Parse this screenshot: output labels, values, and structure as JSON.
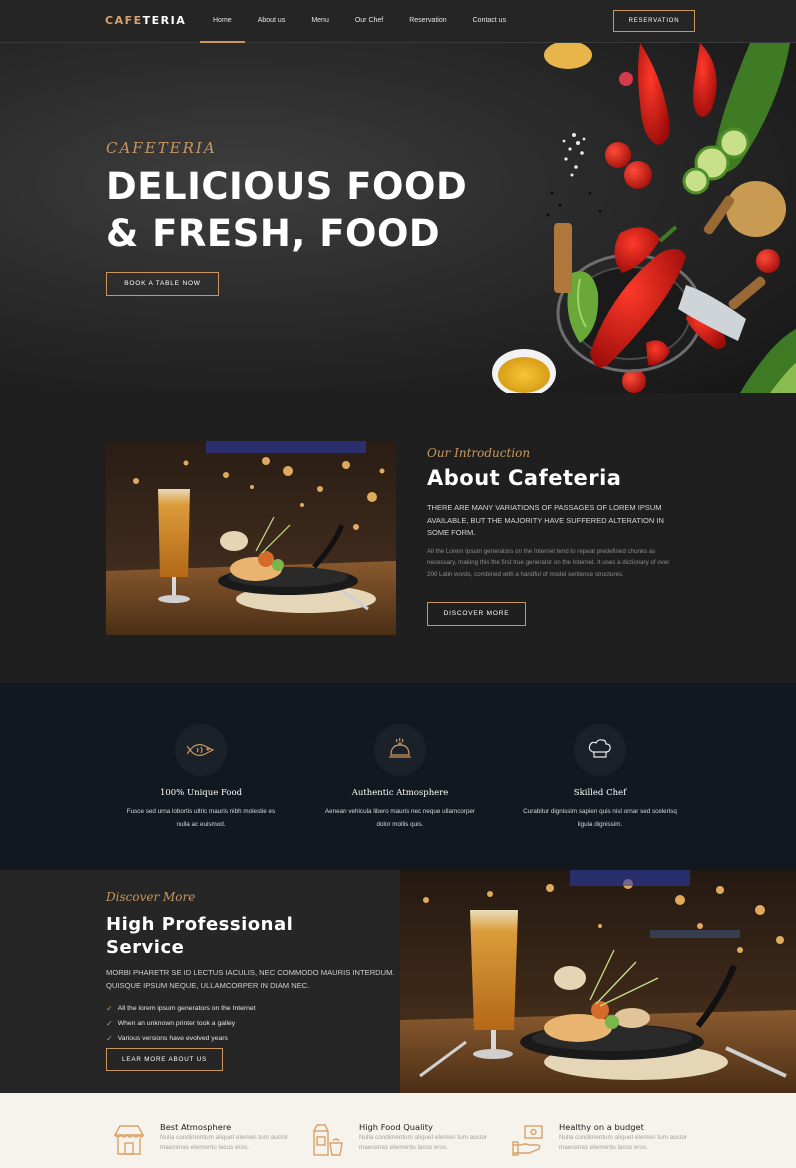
{
  "brand": {
    "accent": "#c8975f",
    "logo_accent": "CAFE",
    "logo_rest": "TERIA"
  },
  "nav": {
    "items": [
      {
        "label": "Home",
        "active": true
      },
      {
        "label": "About us"
      },
      {
        "label": "Menu"
      },
      {
        "label": "Our Chef"
      },
      {
        "label": "Reservation"
      },
      {
        "label": "Contact us"
      }
    ],
    "button": "RESERVATION"
  },
  "hero": {
    "script": "CAFETERIA",
    "title_line1": "DELICIOUS FOOD",
    "title_line2": "& FRESH, FOOD",
    "button": "BOOK A TABLE NOW"
  },
  "about": {
    "script": "Our Introduction",
    "title": "About Cafeteria",
    "lead": "THERE ARE MANY VARIATIONS OF PASSAGES OF LOREM IPSUM AVAILABLE, BUT THE MAJORITY HAVE SUFFERED ALTERATION IN SOME FORM.",
    "body": "All the Lorem Ipsum generators on the Internet tend to repeat predefined chunks as necessary, making this the first true generator on the Internet. It uses a dictionary of over 200 Latin words, combined with a handful of model sentence structures.",
    "button": "DISCOVER MORE"
  },
  "features": [
    {
      "icon": "fish-icon",
      "title": "100% Unique Food",
      "text": "Fusce sed urna lobortis ultric mauris nibh molestie es nulla ac euismod."
    },
    {
      "icon": "cloche-icon",
      "title": "Authentic Atmosphere",
      "text": "Aenean vehicula libero mauris nec neque ullamcorper dolor mollis quis."
    },
    {
      "icon": "chef-hat-icon",
      "title": "Skilled Chef",
      "text": "Curabitur dignissim sapien quis nisl ornar sed scelerisq ligula dignissim."
    }
  ],
  "service": {
    "script": "Discover More",
    "title_line1": "High Professional",
    "title_line2": "Service",
    "lead": "MORBI PHARETR SE ID LECTUS IACULIS, NEC COMMODO MAURIS INTERDUM. QUISQUE IPSUM NEQUE, ULLAMCORPER IN DIAM NEC.",
    "checklist": [
      "All the lorem ipsum generators on the Internet",
      "When an unknown printer took a galley",
      "Various versions have evolved years"
    ],
    "button": "LEAR MORE ABOUT US"
  },
  "perks": [
    {
      "icon": "shop-icon",
      "title": "Best Atmosphere",
      "text": "Nulla condimentum aliquet elemen tum auctor maecenas elementu lacus eros."
    },
    {
      "icon": "food-box-icon",
      "title": "High Food Quality",
      "text": "Nulla condimentum aliquet elemen tum auctor maecenas elementu lacus eros."
    },
    {
      "icon": "money-hand-icon",
      "title": "Healthy on a budget",
      "text": "Nulla condimentum aliquet elemen tum auctor maecenas elementu lacus eros."
    }
  ]
}
